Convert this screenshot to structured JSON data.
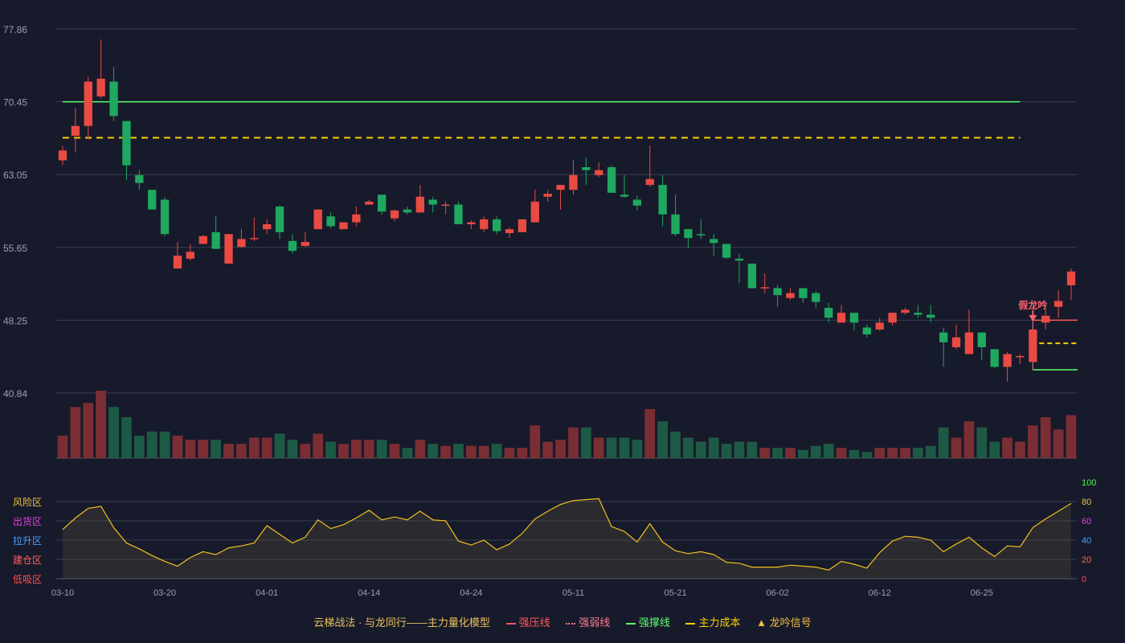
{
  "chart_data": {
    "type": "candlestick",
    "price_axis": {
      "ticks": [
        "77.86",
        "70.45",
        "63.05",
        "55.65",
        "48.25",
        "40.84"
      ],
      "min": 40.84,
      "max": 77.86
    },
    "oscillator_axis": {
      "ticks": [
        "100",
        "80",
        "60",
        "40",
        "20",
        "0"
      ],
      "min": 0,
      "max": 100
    },
    "zone_labels": [
      "风险区",
      "出货区",
      "拉升区",
      "建仓区",
      "低吸区"
    ],
    "zone_colors": [
      "#f0c040",
      "#e040e0",
      "#4a9eff",
      "#ff6060",
      "#ff5050"
    ],
    "x_tick_labels": [
      "03-10",
      "03-20",
      "04-01",
      "04-14",
      "04-24",
      "05-11",
      "05-21",
      "06-02",
      "06-12",
      "06-25"
    ],
    "x_tick_index": [
      0,
      8,
      16,
      24,
      32,
      40,
      48,
      56,
      64,
      72
    ],
    "candles": [
      [
        64.5,
        65.5,
        66.0,
        64.0
      ],
      [
        67.0,
        68.0,
        69.8,
        65.3
      ],
      [
        68.0,
        72.5,
        73.0,
        66.6
      ],
      [
        71.0,
        72.8,
        76.8,
        70.8
      ],
      [
        72.5,
        69.0,
        74.0,
        68.5
      ],
      [
        68.5,
        64.0,
        68.5,
        62.5
      ],
      [
        63.0,
        62.2,
        63.5,
        61.5
      ],
      [
        61.5,
        59.5,
        61.5,
        59.5
      ],
      [
        60.5,
        57.0,
        60.8,
        56.8
      ],
      [
        53.5,
        54.8,
        56.2,
        53.5
      ],
      [
        54.5,
        55.2,
        56.0,
        54.3
      ],
      [
        56.0,
        56.8,
        56.9,
        56.0
      ],
      [
        57.2,
        55.5,
        58.8,
        55.5
      ],
      [
        54.0,
        57.0,
        57.0,
        54.0
      ],
      [
        55.7,
        56.5,
        57.5,
        55.6
      ],
      [
        56.5,
        56.6,
        58.7,
        56.3
      ],
      [
        57.5,
        58.0,
        58.5,
        57.0
      ],
      [
        59.8,
        57.2,
        59.9,
        56.5
      ],
      [
        56.3,
        55.3,
        57.0,
        55.0
      ],
      [
        55.8,
        56.2,
        57.2,
        55.7
      ],
      [
        57.5,
        59.5,
        59.5,
        57.5
      ],
      [
        58.8,
        57.8,
        59.2,
        57.6
      ],
      [
        57.5,
        58.2,
        58.2,
        57.5
      ],
      [
        58.2,
        59.0,
        59.8,
        57.8
      ],
      [
        60.0,
        60.3,
        60.5,
        60.0
      ],
      [
        61.0,
        59.3,
        61.0,
        59.0
      ],
      [
        58.6,
        59.4,
        59.5,
        58.3
      ],
      [
        59.5,
        59.2,
        59.8,
        59.0
      ],
      [
        59.2,
        60.8,
        62.0,
        59.2
      ],
      [
        60.5,
        60.0,
        60.8,
        59.2
      ],
      [
        60.0,
        60.0,
        60.3,
        59.0
      ],
      [
        60.0,
        58.0,
        60.3,
        58.0
      ],
      [
        58.0,
        58.2,
        58.4,
        57.5
      ],
      [
        57.5,
        58.5,
        58.8,
        57.2
      ],
      [
        58.5,
        57.3,
        58.8,
        57.0
      ],
      [
        57.1,
        57.5,
        57.7,
        56.6
      ],
      [
        57.2,
        58.5,
        58.5,
        57.2
      ],
      [
        58.2,
        60.3,
        61.5,
        58.2
      ],
      [
        60.8,
        61.1,
        61.5,
        60.3
      ],
      [
        61.5,
        62.0,
        62.0,
        59.5
      ],
      [
        61.5,
        63.0,
        64.5,
        61.0
      ],
      [
        63.8,
        63.5,
        64.8,
        62.0
      ],
      [
        63.0,
        63.5,
        64.3,
        62.8
      ],
      [
        63.8,
        61.2,
        64.0,
        61.2
      ],
      [
        61.0,
        60.8,
        63.0,
        60.7
      ],
      [
        60.5,
        59.9,
        60.9,
        59.4
      ],
      [
        62.0,
        62.6,
        66.0,
        61.8
      ],
      [
        62.0,
        59.0,
        63.0,
        57.8
      ],
      [
        59.0,
        57.0,
        61.0,
        56.8
      ],
      [
        57.5,
        56.6,
        57.5,
        55.6
      ],
      [
        57.0,
        56.9,
        58.5,
        56.5
      ],
      [
        56.5,
        56.1,
        57.0,
        54.8
      ],
      [
        56.0,
        54.6,
        56.0,
        54.5
      ],
      [
        54.5,
        54.3,
        55.0,
        52.0
      ],
      [
        54.0,
        51.5,
        54.0,
        51.5
      ],
      [
        51.5,
        51.6,
        53.0,
        51.0
      ],
      [
        51.5,
        50.8,
        51.8,
        49.6
      ],
      [
        50.5,
        51.0,
        51.5,
        50.3
      ],
      [
        51.5,
        50.5,
        51.5,
        50.0
      ],
      [
        51.0,
        50.1,
        51.2,
        49.5
      ],
      [
        49.5,
        48.5,
        50.0,
        48.0
      ],
      [
        48.0,
        49.0,
        49.8,
        48.0
      ],
      [
        49.0,
        48.0,
        49.0,
        47.2
      ],
      [
        47.5,
        46.8,
        47.8,
        46.5
      ],
      [
        47.3,
        48.0,
        48.5,
        47.2
      ],
      [
        48.0,
        49.0,
        49.0,
        47.7
      ],
      [
        49.0,
        49.3,
        49.5,
        48.8
      ],
      [
        49.0,
        48.8,
        49.8,
        48.5
      ],
      [
        48.8,
        48.5,
        49.8,
        48.0
      ],
      [
        47.0,
        46.0,
        47.5,
        43.5
      ],
      [
        45.5,
        46.5,
        47.8,
        45.3
      ],
      [
        44.8,
        47.0,
        49.3,
        44.8
      ],
      [
        47.0,
        45.5,
        47.0,
        44.2
      ],
      [
        45.3,
        43.5,
        45.3,
        43.4
      ],
      [
        43.5,
        44.8,
        45.0,
        42.0
      ],
      [
        44.5,
        44.6,
        44.8,
        43.8
      ],
      [
        44.0,
        47.3,
        47.3,
        44.0
      ],
      [
        48.0,
        48.7,
        49.5,
        47.3
      ],
      [
        49.6,
        50.2,
        51.3,
        48.5
      ],
      [
        51.8,
        53.2,
        53.5,
        50.3
      ]
    ],
    "volumes": [
      11,
      25,
      27,
      33,
      25,
      20,
      11,
      13,
      13,
      11,
      9,
      9,
      9,
      7,
      7,
      10,
      10,
      12,
      9,
      7,
      12,
      8,
      7,
      9,
      9,
      9,
      7,
      5,
      9,
      7,
      6,
      7,
      6,
      6,
      7,
      5,
      5,
      16,
      8,
      9,
      15,
      15,
      10,
      10,
      10,
      9,
      24,
      18,
      13,
      10,
      8,
      10,
      7,
      8,
      8,
      5,
      5,
      5,
      4,
      6,
      7,
      5,
      4,
      3,
      5,
      5,
      5,
      5,
      6,
      15,
      10,
      18,
      15,
      8,
      10,
      8,
      16,
      20,
      14,
      21
    ],
    "oscillator": [
      51,
      63,
      73,
      75,
      53,
      37,
      31,
      24,
      18,
      13,
      22,
      28,
      25,
      32,
      34,
      37,
      55,
      46,
      37,
      43,
      61,
      52,
      56,
      63,
      71,
      61,
      64,
      61,
      70,
      61,
      60,
      39,
      35,
      40,
      30,
      36,
      47,
      62,
      70,
      77,
      81,
      82,
      83,
      54,
      49,
      38,
      57,
      38,
      29,
      26,
      28,
      25,
      17,
      16,
      12,
      12,
      12,
      14,
      13,
      12,
      9,
      18,
      15,
      11,
      27,
      39,
      44,
      43,
      40,
      28,
      36,
      43,
      32,
      23,
      34,
      33,
      53,
      62,
      70,
      78
    ],
    "lines": {
      "strong_support": {
        "value": 70.45,
        "from": 0,
        "to": 75,
        "color": "#5dff6a"
      },
      "cost_line_upper": {
        "value": 66.8,
        "from": 0,
        "to": 75,
        "color": "#ffd000"
      },
      "strong_resist": {
        "value": 48.25,
        "from": 76,
        "to": 79.5,
        "color": "#ff5a5a"
      },
      "weak_resist_segment": {
        "value": 45.9,
        "from": 76,
        "to": 79.5,
        "color": "#ff7a8a"
      },
      "cost_line_lower": {
        "value": 45.9,
        "from": 76.5,
        "to": 79.5,
        "color": "#ffd000"
      },
      "support_lower": {
        "value": 43.2,
        "from": 76,
        "to": 79.5,
        "color": "#5dff6a"
      }
    },
    "signal": {
      "index": 76,
      "label": "假龙吟",
      "color": "#ff6070"
    },
    "up_color": "#e94b43",
    "down_color": "#1fa860",
    "vol_up_color": "#7a2e33",
    "vol_down_color": "#1d5a45",
    "oscillator_line_color": "#f0c020",
    "legend": {
      "title": "云梯战法 · 与龙同行——主力量化模型",
      "strong_resist": "强压线",
      "weak": "强弱线",
      "support": "强撑线",
      "cost": "主力成本",
      "signal": "龙吟信号"
    }
  }
}
